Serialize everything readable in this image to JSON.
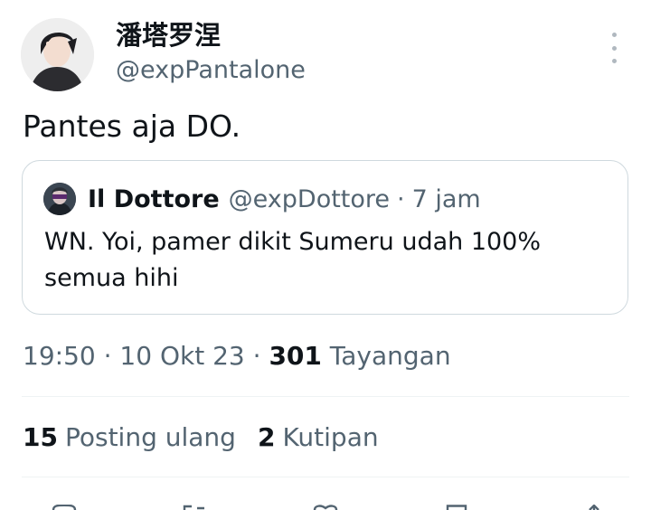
{
  "author": {
    "display_name": "潘塔罗涅",
    "handle": "@expPantalone"
  },
  "tweet": {
    "text": "Pantes aja DO."
  },
  "quote": {
    "name": "Il Dottore",
    "handle": "@expDottore",
    "separator": "·",
    "time": "7 jam",
    "text": "WN. Yoi, pamer dikit Sumeru udah 100% semua hihi"
  },
  "meta": {
    "time": "19:50",
    "sep1": "·",
    "date": "10 Okt 23",
    "sep2": "·",
    "views_count": "301",
    "views_label": "Tayangan"
  },
  "stats": {
    "reposts_count": "15",
    "reposts_label": "Posting ulang",
    "quotes_count": "2",
    "quotes_label": "Kutipan"
  },
  "colors": {
    "text_primary": "#0f1419",
    "text_secondary": "#536471",
    "border": "#cfd9de",
    "divider": "#eff3f4"
  },
  "icons": {
    "more": "more-vertical-icon",
    "actions": [
      "reply-icon",
      "repost-icon",
      "like-icon",
      "bookmark-icon",
      "share-icon"
    ]
  }
}
